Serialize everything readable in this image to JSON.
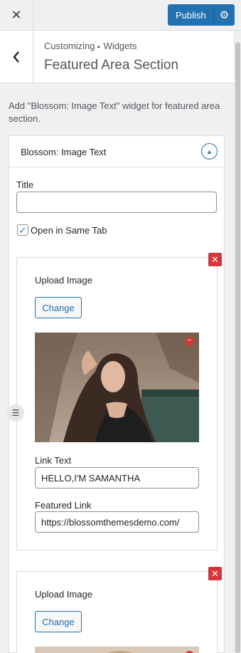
{
  "topbar": {
    "close_icon": "close-icon",
    "publish_label": "Publish",
    "settings_icon": "gear-icon",
    "accent": "#2271b1"
  },
  "header": {
    "back_icon": "chevron-left-icon",
    "breadcrumb_root": "Customizing",
    "breadcrumb_child": "Widgets",
    "title": "Featured Area Section"
  },
  "description": "Add \"Blossom: Image Text\" widget for featured area section.",
  "widget": {
    "title": "Blossom: Image Text",
    "title_field_label": "Title",
    "title_field_value": "",
    "same_tab_label": "Open in Same Tab",
    "same_tab_checked": true,
    "items": [
      {
        "upload_label": "Upload Image",
        "change_label": "Change",
        "link_text_label": "Link Text",
        "link_text_value": "HELLO,I'M SAMANTHA",
        "featured_link_label": "Featured Link",
        "featured_link_value": "https://blossomthemesdemo.com/"
      },
      {
        "upload_label": "Upload Image",
        "change_label": "Change"
      }
    ]
  }
}
